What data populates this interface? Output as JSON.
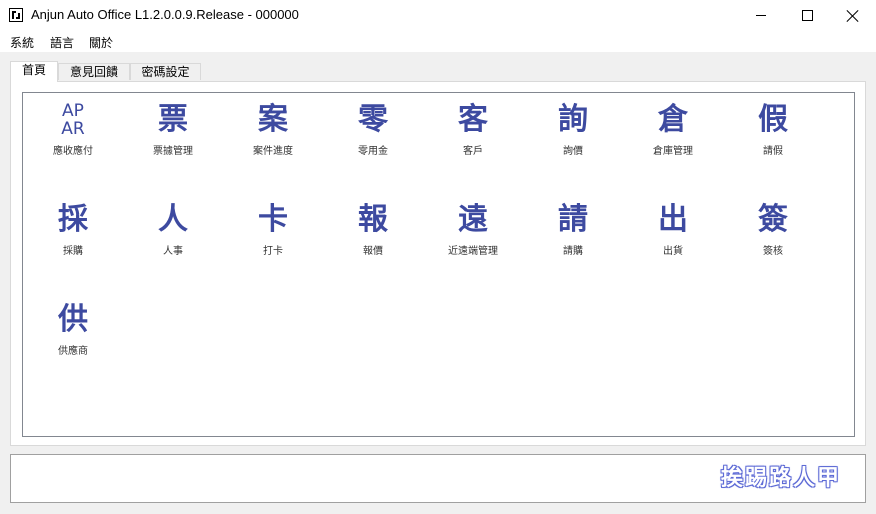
{
  "window": {
    "title": "Anjun Auto Office    L1.2.0.0.9.Release - 000000"
  },
  "menu": [
    "系統",
    "語言",
    "關於"
  ],
  "tabs": [
    {
      "label": "首頁",
      "active": true
    },
    {
      "label": "意見回饋",
      "active": false
    },
    {
      "label": "密碼設定",
      "active": false
    }
  ],
  "tiles": [
    {
      "glyph": "AP AR",
      "icon": "ap-ar-icon",
      "label": "應收應付"
    },
    {
      "glyph": "票",
      "icon": "ticket-icon",
      "label": "票據管理"
    },
    {
      "glyph": "案",
      "icon": "case-icon",
      "label": "案件進度"
    },
    {
      "glyph": "零",
      "icon": "petty-cash-icon",
      "label": "零用金"
    },
    {
      "glyph": "客",
      "icon": "customer-icon",
      "label": "客戶"
    },
    {
      "glyph": "詢",
      "icon": "inquiry-icon",
      "label": "詢價"
    },
    {
      "glyph": "倉",
      "icon": "warehouse-icon",
      "label": "倉庫管理"
    },
    {
      "glyph": "假",
      "icon": "leave-icon",
      "label": "請假"
    },
    {
      "glyph": "採",
      "icon": "purchase-icon",
      "label": "採購"
    },
    {
      "glyph": "人",
      "icon": "hr-icon",
      "label": "人事"
    },
    {
      "glyph": "卡",
      "icon": "punch-card-icon",
      "label": "打卡"
    },
    {
      "glyph": "報",
      "icon": "quote-icon",
      "label": "報價"
    },
    {
      "glyph": "遠",
      "icon": "remote-icon",
      "label": "近遠端管理"
    },
    {
      "glyph": "請",
      "icon": "requisition-icon",
      "label": "請購"
    },
    {
      "glyph": "出",
      "icon": "shipping-icon",
      "label": "出貨"
    },
    {
      "glyph": "簽",
      "icon": "approval-icon",
      "label": "簽核"
    },
    {
      "glyph": "供",
      "icon": "supplier-icon",
      "label": "供應商"
    }
  ],
  "watermark": "挨踢路人甲",
  "colors": {
    "icon_blue": "#3d4aa0",
    "watermark_outline": "#5e6bd6"
  }
}
